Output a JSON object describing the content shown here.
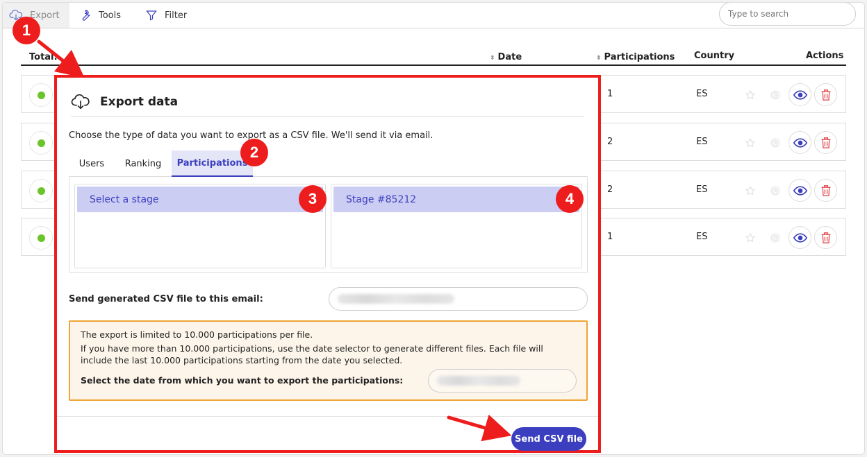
{
  "toolbar": {
    "export_label": "Export",
    "tools_label": "Tools",
    "filter_label": "Filter",
    "search_placeholder": "Type to search"
  },
  "table": {
    "columns": {
      "total": "Total:",
      "date": "Date",
      "participations": "Participations",
      "country": "Country",
      "actions": "Actions"
    },
    "rows": [
      {
        "participations": "1",
        "country": "ES"
      },
      {
        "participations": "2",
        "country": "ES"
      },
      {
        "participations": "2",
        "country": "ES"
      },
      {
        "participations": "1",
        "country": "ES"
      }
    ]
  },
  "modal": {
    "title": "Export data",
    "description": "Choose the type of data you want to export as a CSV file. We'll send it via email.",
    "tabs": [
      "Users",
      "Ranking",
      "Participations"
    ],
    "active_tab": "Participations",
    "stage_list_selected": "Select a stage",
    "stage_selected": "Stage #85212",
    "email_label": "Send generated CSV file to this email:",
    "warning_line1": "The export is limited to 10.000 participations per file.",
    "warning_line2": "If you have more than 10.000 participations, use the date selector to generate different files. Each file will include the last 10.000 participations starting from the date you selected.",
    "date_label": "Select the date from which you want to export the participations:",
    "send_button": "Send CSV file"
  },
  "callouts": [
    "1",
    "2",
    "3",
    "4"
  ],
  "colors": {
    "accent": "#3b3fbf",
    "highlight": "#ee1d1d",
    "status_active": "#6ac42a",
    "warning_border": "#efa434"
  }
}
